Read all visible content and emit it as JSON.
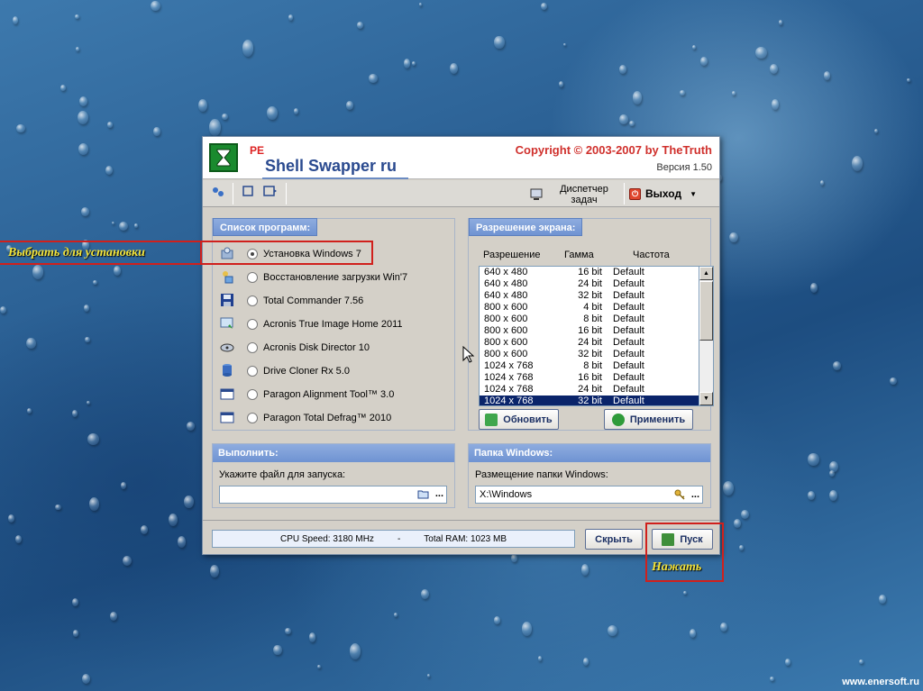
{
  "app": {
    "pe": "PE",
    "title": "Shell Swapper ru",
    "copyright": "Copyright © 2003-2007 by TheTruth",
    "version": "Версия 1.50"
  },
  "toolbar": {
    "taskmgr_line1": "Диспетчер",
    "taskmgr_line2": "задач",
    "exit_label": "Выход"
  },
  "programs": {
    "title": "Список программ:",
    "items": [
      {
        "label": "Установка Windows 7",
        "icon": "setup-icon",
        "selected": true
      },
      {
        "label": "Восстановление загрузки Win'7",
        "icon": "repair-icon",
        "selected": false
      },
      {
        "label": "Total Commander 7.56",
        "icon": "floppy-icon",
        "selected": false
      },
      {
        "label": "Acronis True Image Home 2011",
        "icon": "image-icon",
        "selected": false
      },
      {
        "label": "Acronis Disk Director 10",
        "icon": "disk-icon",
        "selected": false
      },
      {
        "label": "Drive Cloner Rx 5.0",
        "icon": "database-icon",
        "selected": false
      },
      {
        "label": "Paragon Alignment Tool™ 3.0",
        "icon": "window-icon",
        "selected": false
      },
      {
        "label": "Paragon Total Defrag™ 2010",
        "icon": "window-icon",
        "selected": false
      }
    ]
  },
  "resolution": {
    "title": "Разрешение экрана:",
    "columns": [
      "Разрешение",
      "Гамма",
      "Частота"
    ],
    "rows": [
      [
        "640 x 480",
        "16 bit",
        "Default"
      ],
      [
        "640 x 480",
        "24 bit",
        "Default"
      ],
      [
        "640 x 480",
        "32 bit",
        "Default"
      ],
      [
        "800 x 600",
        "4 bit",
        "Default"
      ],
      [
        "800 x 600",
        "8 bit",
        "Default"
      ],
      [
        "800 x 600",
        "16 bit",
        "Default"
      ],
      [
        "800 x 600",
        "24 bit",
        "Default"
      ],
      [
        "800 x 600",
        "32 bit",
        "Default"
      ],
      [
        "1024 x 768",
        "8 bit",
        "Default"
      ],
      [
        "1024 x 768",
        "16 bit",
        "Default"
      ],
      [
        "1024 x 768",
        "24 bit",
        "Default"
      ],
      [
        "1024 x 768",
        "32 bit",
        "Default"
      ]
    ],
    "selected_index": 11,
    "refresh_label": "Обновить",
    "apply_label": "Применить"
  },
  "run": {
    "title": "Выполнить:",
    "label": "Укажите файл для запуска:",
    "value": "",
    "browse": "..."
  },
  "windows_folder": {
    "title": "Папка Windows:",
    "label": "Размещение папки Windows:",
    "value": "X:\\Windows",
    "browse": "..."
  },
  "status": {
    "cpu": "CPU Speed: 3180 MHz",
    "sep": "-",
    "ram": "Total RAM: 1023 MB"
  },
  "buttons": {
    "hide": "Скрыть",
    "start": "Пуск"
  },
  "annotations": {
    "select": "Выбрать для установки",
    "press": "Нажать",
    "color": "#d0201c"
  },
  "watermark": "www.enersoft.ru"
}
